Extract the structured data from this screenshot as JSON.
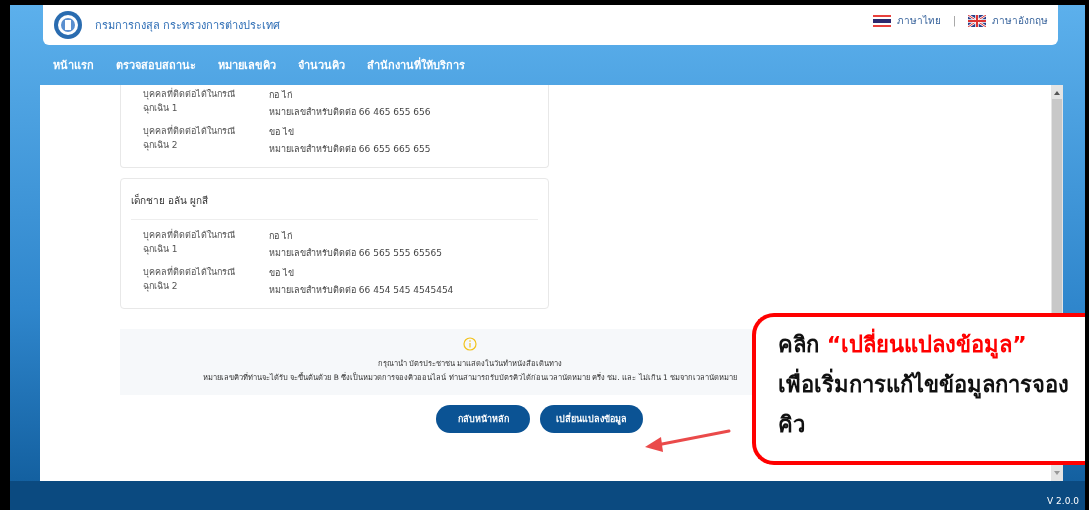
{
  "header": {
    "org_name": "กรมการกงสุล กระทรวงการต่างประเทศ",
    "languages": [
      {
        "kind": "thai",
        "label": "ภาษาไทย"
      },
      {
        "kind": "uk",
        "label": "ภาษาอังกฤษ"
      }
    ],
    "separator": "|"
  },
  "nav": [
    "หน้าแรก",
    "ตรวจสอบสถานะ",
    "หมายเลขคิว",
    "จำนวนคิว",
    "สำนักงานที่ให้บริการ"
  ],
  "cards": [
    {
      "contacts": [
        {
          "label": "บุคคลที่ติดต่อได้ในกรณีฉุกเฉิน 1",
          "name": "กอ ไก่",
          "phone": "หมายเลขสำหรับติดต่อ 66 465 655 656"
        },
        {
          "label": "บุคคลที่ติดต่อได้ในกรณีฉุกเฉิน 2",
          "name": "ขอ ไข่",
          "phone": "หมายเลขสำหรับติดต่อ  66 655 665 655"
        }
      ]
    },
    {
      "name": "เด็กชาย อลัน  ผูกสี",
      "contacts": [
        {
          "label": "บุคคลที่ติดต่อได้ในกรณีฉุกเฉิน 1",
          "name": "กอ ไก่",
          "phone": "หมายเลขสำหรับติดต่อ 66 565 555 65565"
        },
        {
          "label": "บุคคลที่ติดต่อได้ในกรณีฉุกเฉิน 2",
          "name": "ขอ ไข่",
          "phone": "หมายเลขสำหรับติดต่อ  66 454 545 4545454"
        }
      ]
    }
  ],
  "info": [
    "กรุณานำ บัตรประชาชน มาแสดงในวันทำหนังสือเดินทาง",
    "หมายเลขคิวที่ท่านจะได้รับ จะขึ้นต้นด้วย B ซึ่งเป็นหมวดการจองคิวออนไลน์ ท่านสามารถรับบัตรคิวได้ก่อนเวลานัดหมาย ครึ่ง ชม. และ ไม่เกิน 1 ชมจากเวลานัดหมาย"
  ],
  "buttons": [
    "กลับหน้าหลัก",
    "เปลี่ยนแปลงข้อมูล"
  ],
  "callout": {
    "lead": "คลิก",
    "highlight": "“เปลี่ยนแปลงข้อมูล”",
    "text": "เพื่อเริ่มการแก้ไขข้อมูลการจองคิว"
  },
  "version": "V 2.0.0"
}
